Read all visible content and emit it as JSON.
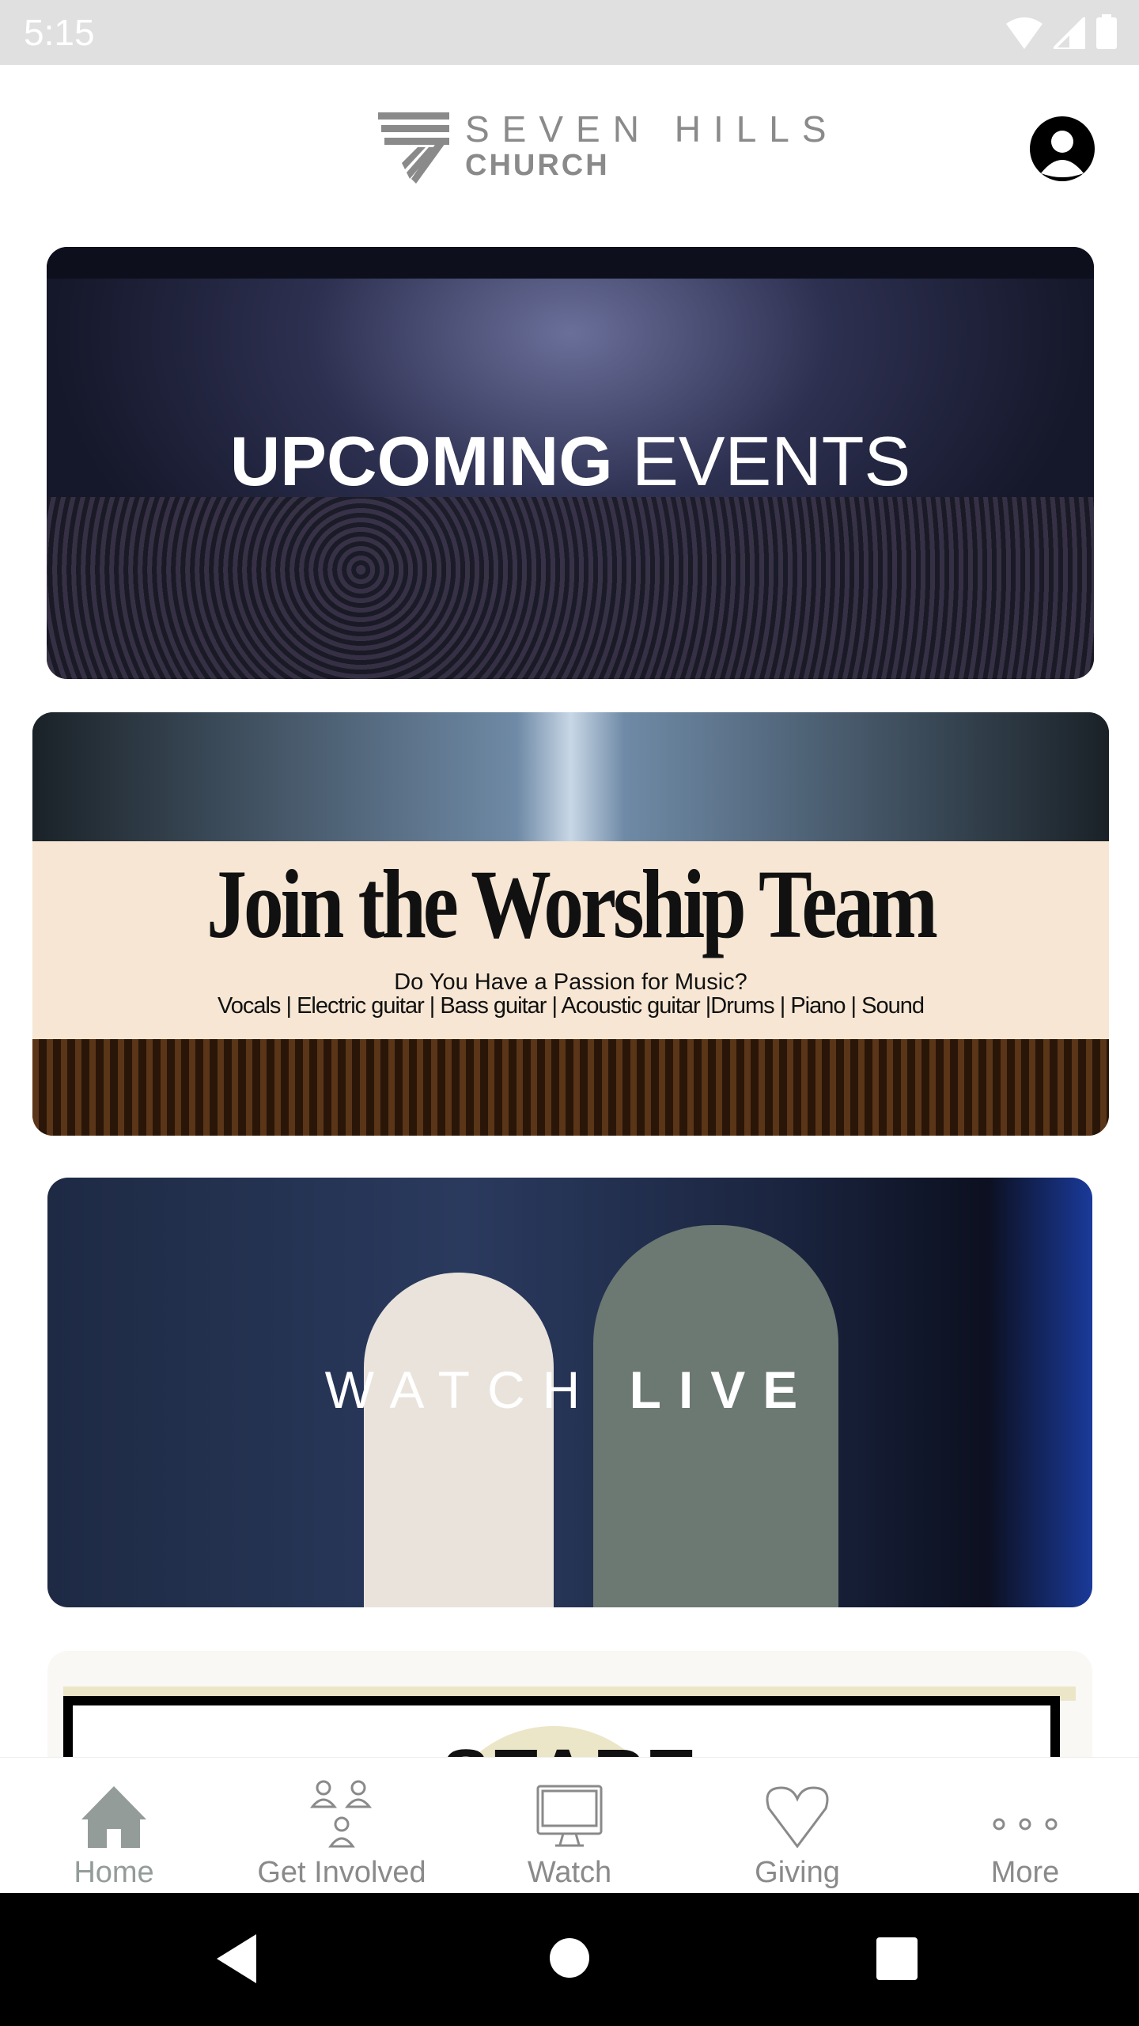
{
  "status_bar": {
    "time": "5:15"
  },
  "header": {
    "logo_line1": "SEVEN HILLS",
    "logo_line2": "CHURCH"
  },
  "cards": [
    {
      "title_bold": "UPCOMING",
      "title_light": " EVENTS"
    },
    {
      "title": "Join the Worship Team",
      "subtitle": "Do You Have a Passion for Music?",
      "roles": "Vocals | Electric guitar | Bass guitar | Acoustic guitar |Drums | Piano | Sound"
    },
    {
      "title_light": "WATCH ",
      "title_bold": "LIVE"
    },
    {
      "partial_text": "START"
    }
  ],
  "bottom_nav": {
    "items": [
      {
        "label": "Home",
        "icon": "home-icon",
        "active": true
      },
      {
        "label": "Get Involved",
        "icon": "people-icon"
      },
      {
        "label": "Watch",
        "icon": "monitor-icon"
      },
      {
        "label": "Giving",
        "icon": "heart-icon"
      },
      {
        "label": "More",
        "icon": "more-icon"
      }
    ]
  },
  "colors": {
    "status_bar": "#e0e0e0",
    "active_nav": "#939c98",
    "inactive_nav": "#8a8a8a",
    "banner_cream": "#f6e6d3"
  }
}
